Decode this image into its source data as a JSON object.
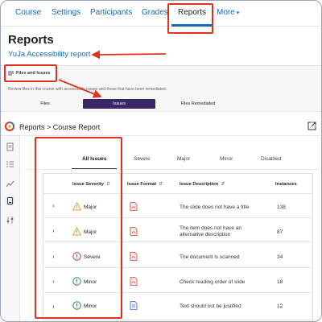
{
  "nav": {
    "tabs": [
      {
        "label": "Course"
      },
      {
        "label": "Settings"
      },
      {
        "label": "Participants"
      },
      {
        "label": "Grades"
      },
      {
        "label": "Reports"
      },
      {
        "label": "More"
      }
    ],
    "active": "Reports"
  },
  "page": {
    "title": "Reports",
    "yuja_link": "YuJa Accessibility report"
  },
  "files_section": {
    "tab_label": "Files and Issues",
    "description": "Review files in this course with accessibility issues and those that have been remediated.",
    "segments": [
      "Files",
      "Issues",
      "Files Remediated"
    ],
    "active_segment": "Issues"
  },
  "report": {
    "breadcrumb": "Reports > Course Report"
  },
  "issue_tabs": {
    "items": [
      "All Issues",
      "Severe",
      "Major",
      "Minor",
      "Disabled"
    ],
    "active": "All Issues"
  },
  "table": {
    "columns": [
      "Issue Severity",
      "Issue Format",
      "Issue Description",
      "Instances"
    ],
    "rows": [
      {
        "severity": "Major",
        "severity_icon": "warning-triangle-icon",
        "format_icon": "pdf-file-icon",
        "description": "The slide does not have a title",
        "instances": "138"
      },
      {
        "severity": "Major",
        "severity_icon": "warning-triangle-icon",
        "format_icon": "pdf-file-icon",
        "description": "The item does not have an alternative description",
        "instances": "87"
      },
      {
        "severity": "Severe",
        "severity_icon": "error-circle-icon",
        "format_icon": "pdf-file-icon",
        "description": "The document is scanned",
        "instances": "34"
      },
      {
        "severity": "Minor",
        "severity_icon": "info-circle-icon",
        "format_icon": "pdf-file-icon",
        "description": "Check reading order of slide",
        "instances": "18"
      },
      {
        "severity": "Minor",
        "severity_icon": "info-circle-icon",
        "format_icon": "doc-file-icon",
        "description": "Text should not be justified",
        "instances": "12"
      }
    ]
  },
  "colors": {
    "link": "#0f6cbf",
    "highlight": "#e1341e",
    "segment_active": "#3a2767",
    "major": "#e9a21f",
    "severe": "#c0392b",
    "minor": "#2e8b3a",
    "pdf": "#d9413a",
    "doc": "#3b6fd6"
  }
}
